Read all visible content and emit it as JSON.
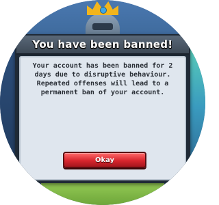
{
  "dialog": {
    "title": "You have been banned!",
    "message": "Your account has been banned for 2 days due to disruptive behaviour. Repeated offenses will lead to a permanent ban of your account.",
    "okay_label": "Okay"
  },
  "colors": {
    "header": "#4a5766",
    "body": "#dfe6ee",
    "button": "#d8262e",
    "crown": "#f2b51d"
  }
}
